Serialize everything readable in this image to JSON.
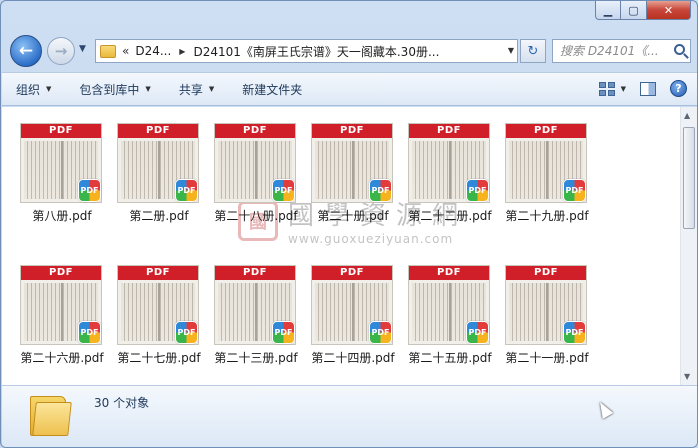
{
  "window": {
    "caption_buttons": [
      "minimize",
      "maximize",
      "close"
    ]
  },
  "address_bar": {
    "chevrons": "«",
    "crumbs": [
      "D24...",
      "D24101《南屏王氏宗谱》天一阁藏本.30册..."
    ]
  },
  "search": {
    "placeholder": "搜索 D24101《..."
  },
  "toolbar": {
    "organize": "组织",
    "include_in_library": "包含到库中",
    "share": "共享",
    "new_folder": "新建文件夹"
  },
  "files": [
    {
      "name": "第八册.pdf"
    },
    {
      "name": "第二册.pdf"
    },
    {
      "name": "第二十八册.pdf"
    },
    {
      "name": "第二十册.pdf"
    },
    {
      "name": "第二十二册.pdf"
    },
    {
      "name": "第二十九册.pdf"
    },
    {
      "name": "第二十六册.pdf"
    },
    {
      "name": "第二十七册.pdf"
    },
    {
      "name": "第二十三册.pdf"
    },
    {
      "name": "第二十四册.pdf"
    },
    {
      "name": "第二十五册.pdf"
    },
    {
      "name": "第二十一册.pdf"
    }
  ],
  "thumbnail": {
    "banner": "PDF",
    "badge": "PDF"
  },
  "watermark": {
    "seal": "國",
    "title": "國學資源網",
    "url": "www.guoxueziyuan.com"
  },
  "status": {
    "count_text": "30 个对象"
  },
  "colors": {
    "pdf_banner": "#d11f2a",
    "window_frame": "#bcd1ec",
    "close_button": "#c7463a"
  }
}
